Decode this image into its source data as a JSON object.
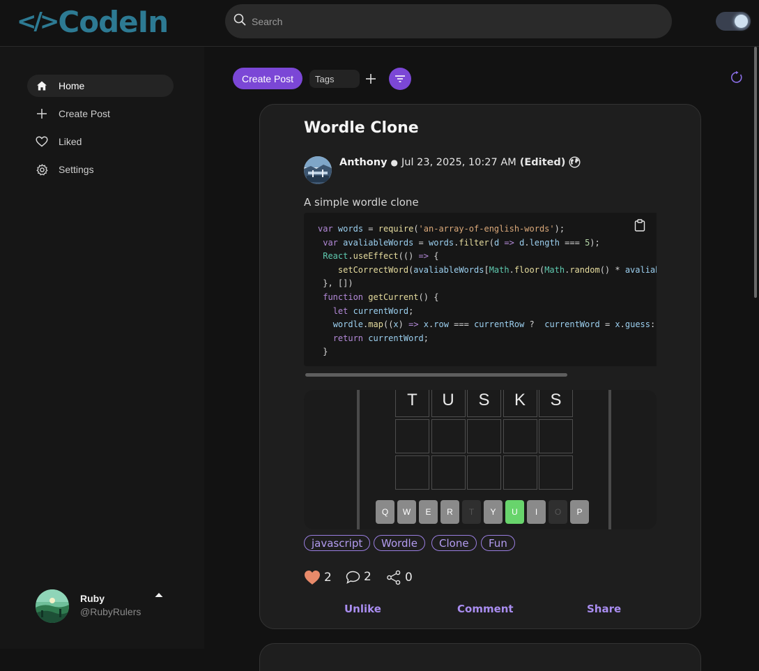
{
  "app": {
    "logo_text": "CodeIn",
    "logo_symbol": "</>"
  },
  "search": {
    "placeholder": "Search"
  },
  "colors": {
    "accent": "#7b47d6",
    "logo": "#2d7a93",
    "tag": "#b39cf0",
    "heart": "#e88a6a",
    "green_key": "#68d46c"
  },
  "sidebar": {
    "items": [
      {
        "label": "Home",
        "icon": "home-icon",
        "active": true
      },
      {
        "label": "Create Post",
        "icon": "plus-icon",
        "active": false
      },
      {
        "label": "Liked",
        "icon": "heart-icon",
        "active": false
      },
      {
        "label": "Settings",
        "icon": "gear-icon",
        "active": false
      }
    ],
    "user": {
      "name": "Ruby",
      "handle": "@RubyRulers"
    }
  },
  "toolbar": {
    "create_label": "Create Post",
    "tags_placeholder": "Tags"
  },
  "post": {
    "title": "Wordle Clone",
    "author": "Anthony",
    "date": "Jul 23, 2025, 10:27 AM",
    "edited": "(Edited)",
    "description": "A simple wordle clone",
    "code_lines": [
      "var words = require('an-array-of-english-words');",
      " var avaliableWords = words.filter(d => d.length === 5);",
      " React.useEffect(() => {",
      "    setCorrectWord(avaliableWords[Math.floor(Math.random() * avaliab",
      " }, [])",
      " function getCurrent() {",
      "   let currentWord;",
      "   wordle.map((x) => x.row === currentRow ?  currentWord = x.guess:",
      "   return currentWord;",
      " }"
    ],
    "wordle": {
      "guess": [
        "T",
        "U",
        "S",
        "K",
        "S"
      ],
      "keyboard": [
        {
          "k": "Q",
          "state": "used"
        },
        {
          "k": "W",
          "state": "used"
        },
        {
          "k": "E",
          "state": "used"
        },
        {
          "k": "R",
          "state": "used"
        },
        {
          "k": "T",
          "state": "absent"
        },
        {
          "k": "Y",
          "state": "used"
        },
        {
          "k": "U",
          "state": "correct"
        },
        {
          "k": "I",
          "state": "used"
        },
        {
          "k": "O",
          "state": "absent"
        },
        {
          "k": "P",
          "state": "used"
        }
      ]
    },
    "tags": [
      "javascript",
      "Wordle",
      "Clone",
      "Fun"
    ],
    "likes": "2",
    "comments": "2",
    "shares": "0",
    "actions": {
      "unlike": "Unlike",
      "comment": "Comment",
      "share": "Share"
    }
  }
}
